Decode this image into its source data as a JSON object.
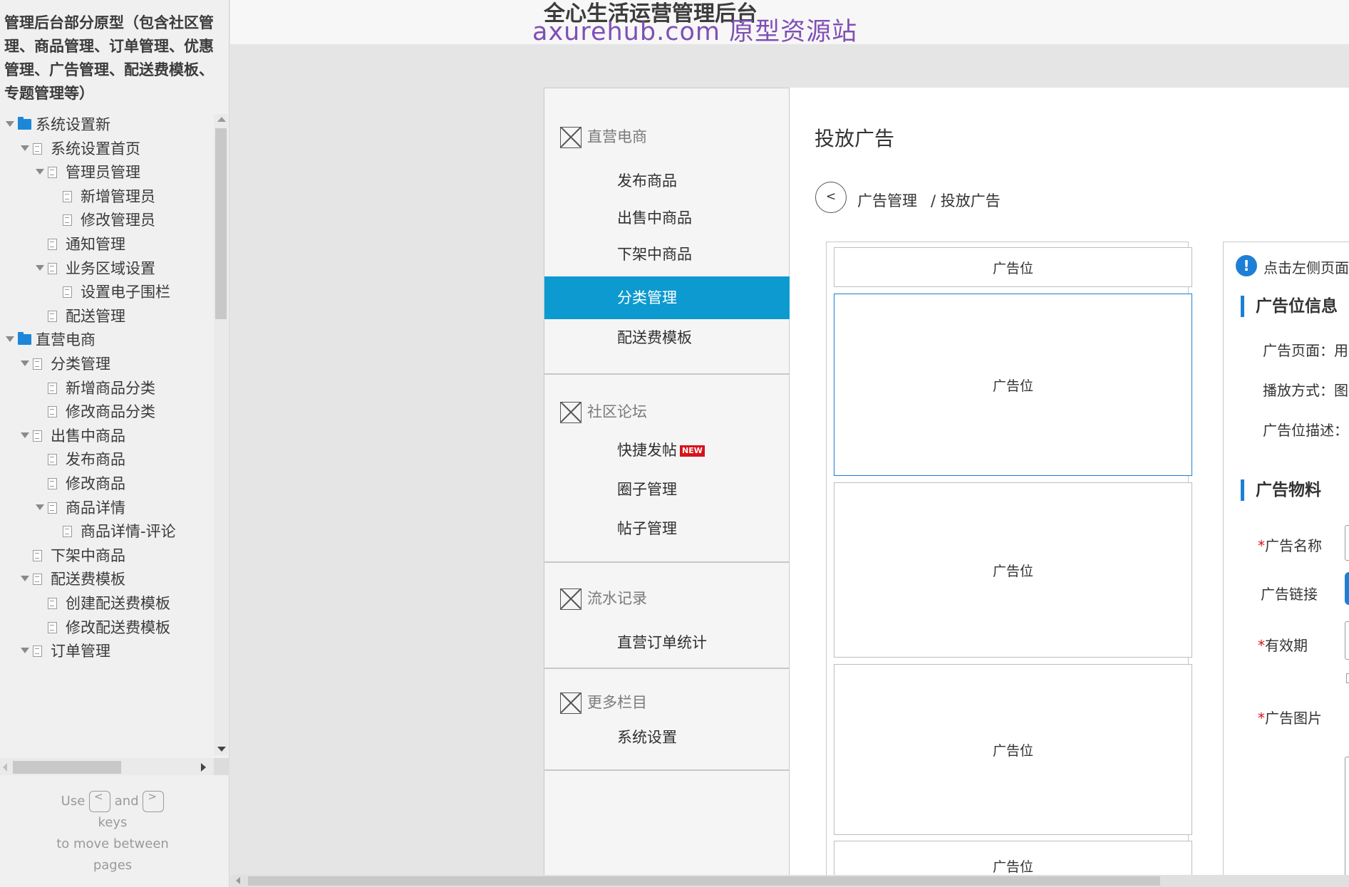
{
  "project": {
    "title": "管理后台部分原型（包含社区管理、商品管理、订单管理、优惠管理、广告管理、配送费模板、专题管理等）"
  },
  "sitemap": {
    "nodes": [
      {
        "label": "系统设置新",
        "type": "folder",
        "expanded": true
      },
      {
        "label": "系统设置首页",
        "type": "page",
        "expanded": true
      },
      {
        "label": "管理员管理",
        "type": "page",
        "expanded": true
      },
      {
        "label": "新增管理员",
        "type": "page"
      },
      {
        "label": "修改管理员",
        "type": "page"
      },
      {
        "label": "通知管理",
        "type": "page"
      },
      {
        "label": "业务区域设置",
        "type": "page",
        "expanded": true
      },
      {
        "label": "设置电子围栏",
        "type": "page"
      },
      {
        "label": "配送管理",
        "type": "page"
      },
      {
        "label": "直营电商",
        "type": "folder",
        "expanded": true
      },
      {
        "label": "分类管理",
        "type": "page",
        "expanded": true
      },
      {
        "label": "新增商品分类",
        "type": "page"
      },
      {
        "label": "修改商品分类",
        "type": "page"
      },
      {
        "label": "出售中商品",
        "type": "page",
        "expanded": true
      },
      {
        "label": "发布商品",
        "type": "page"
      },
      {
        "label": "修改商品",
        "type": "page"
      },
      {
        "label": "商品详情",
        "type": "page",
        "expanded": true
      },
      {
        "label": "商品详情-评论",
        "type": "page"
      },
      {
        "label": "下架中商品",
        "type": "page"
      },
      {
        "label": "配送费模板",
        "type": "page",
        "expanded": true
      },
      {
        "label": "创建配送费模板",
        "type": "page"
      },
      {
        "label": "修改配送费模板",
        "type": "page"
      },
      {
        "label": "订单管理",
        "type": "page",
        "expanded": true
      }
    ]
  },
  "hint": {
    "use": "Use",
    "prev_key": "<",
    "and": "and",
    "next_key": ">",
    "keys": "keys",
    "line2": "to move between",
    "line3": "pages"
  },
  "header": {
    "app_title": "全心生活运营管理后台",
    "watermark": "axurehub.com 原型资源站"
  },
  "menu": {
    "sections": [
      {
        "title": "直营电商",
        "items": [
          "发布商品",
          "出售中商品",
          "下架中商品",
          "分类管理",
          "配送费模板"
        ]
      },
      {
        "title": "社区论坛",
        "items": [
          "快捷发帖",
          "圈子管理",
          "帖子管理"
        ]
      },
      {
        "title": "流水记录",
        "items": [
          "直营订单统计"
        ]
      },
      {
        "title": "更多栏目",
        "items": [
          "系统设置"
        ]
      }
    ],
    "active_item": "分类管理",
    "new_badge": "NEW"
  },
  "content": {
    "page_title": "投放广告",
    "back_label": "<",
    "breadcrumb": [
      "广告管理",
      "/ 投放广告"
    ],
    "slots": [
      "广告位",
      "广告位",
      "广告位",
      "广告位",
      "广告位"
    ],
    "info": {
      "tip": "点击左侧页面",
      "section1": "广告位信息",
      "page_label": "广告页面：用",
      "play_label": "播放方式：图",
      "desc_label": "广告位描述：",
      "section2": "广告物料",
      "name_label": "广告名称",
      "link_label": "广告链接",
      "valid_label": "有效期",
      "image_label": "广告图片",
      "required_mark": "*",
      "info_mark": "!"
    }
  },
  "colors": {
    "accent": "#0d9ad0",
    "link_blue": "#1e7fd6",
    "badge_red": "#d7131b",
    "folder_blue": "#1c87d9",
    "watermark": "#7f4fb5"
  }
}
